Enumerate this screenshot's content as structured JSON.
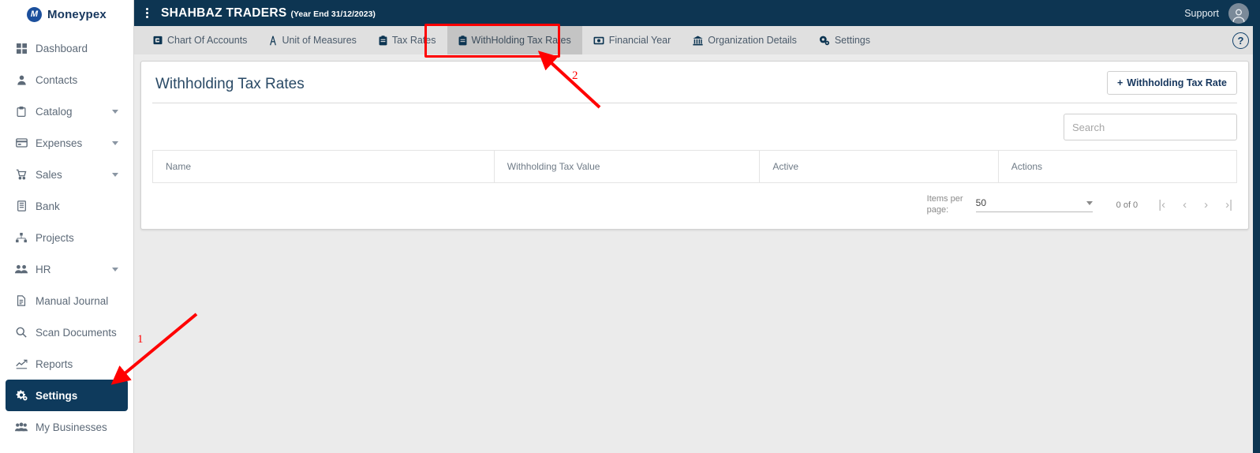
{
  "brand": {
    "name": "Moneypex",
    "mark": "M",
    "accent": "#1b4f9c",
    "navy": "#0d3552"
  },
  "sidebar": {
    "items": [
      {
        "label": "Dashboard",
        "icon": "grid-icon",
        "caret": false,
        "active": false
      },
      {
        "label": "Contacts",
        "icon": "person-icon",
        "caret": false,
        "active": false
      },
      {
        "label": "Catalog",
        "icon": "clipboard-icon",
        "caret": true,
        "active": false
      },
      {
        "label": "Expenses",
        "icon": "credit-card-icon",
        "caret": true,
        "active": false
      },
      {
        "label": "Sales",
        "icon": "cart-icon",
        "caret": true,
        "active": false
      },
      {
        "label": "Bank",
        "icon": "bank-icon",
        "caret": false,
        "active": false
      },
      {
        "label": "Projects",
        "icon": "sitemap-icon",
        "caret": false,
        "active": false
      },
      {
        "label": "HR",
        "icon": "people-icon",
        "caret": true,
        "active": false
      },
      {
        "label": "Manual Journal",
        "icon": "file-icon",
        "caret": false,
        "active": false
      },
      {
        "label": "Scan Documents",
        "icon": "search-icon",
        "caret": false,
        "active": false
      },
      {
        "label": "Reports",
        "icon": "chart-icon",
        "caret": false,
        "active": false
      },
      {
        "label": "Settings",
        "icon": "gears-icon",
        "caret": false,
        "active": true
      },
      {
        "label": "My Businesses",
        "icon": "group-icon",
        "caret": false,
        "active": false
      }
    ]
  },
  "topbar": {
    "kebab_icon": "kebab-menu-icon",
    "org_name": "SHAHBAZ TRADERS",
    "year_end": "(Year End 31/12/2023)",
    "support_label": "Support",
    "avatar_icon": "user-avatar-icon"
  },
  "tabs": {
    "items": [
      {
        "label": "Chart Of Accounts",
        "icon": "chart-of-accounts-icon",
        "active": false
      },
      {
        "label": "Unit of Measures",
        "icon": "ruler-icon",
        "active": false
      },
      {
        "label": "Tax Rates",
        "icon": "clipboard-icon",
        "active": false
      },
      {
        "label": "WithHolding Tax Rates",
        "icon": "clipboard-icon",
        "active": true
      },
      {
        "label": "Financial Year",
        "icon": "money-icon",
        "active": false
      },
      {
        "label": "Organization Details",
        "icon": "bank-icon",
        "active": false
      },
      {
        "label": "Settings",
        "icon": "gears-icon",
        "active": false
      }
    ],
    "help_label": "?",
    "help_icon": "help-circle-icon"
  },
  "page": {
    "title": "Withholding Tax Rates",
    "add_button_label": "Withholding Tax Rate",
    "add_button_icon": "plus-icon",
    "search_placeholder": "Search",
    "search_value": ""
  },
  "table": {
    "columns": [
      "Name",
      "Withholding Tax Value",
      "Active",
      "Actions"
    ],
    "rows": []
  },
  "paginator": {
    "items_per_page_label": "Items per page:",
    "items_per_page_value": "50",
    "range_label": "0 of 0",
    "first_icon": "first-page-icon",
    "prev_icon": "previous-page-icon",
    "next_icon": "next-page-icon",
    "last_icon": "last-page-icon",
    "first_glyph": "|‹",
    "prev_glyph": "‹",
    "next_glyph": "›",
    "last_glyph": "›|"
  },
  "annotations": {
    "color": "#ff0000",
    "markers": [
      {
        "number": "1",
        "target": "sidebar-item-settings"
      },
      {
        "number": "2",
        "target": "tab-withholding-tax-rates"
      }
    ]
  }
}
